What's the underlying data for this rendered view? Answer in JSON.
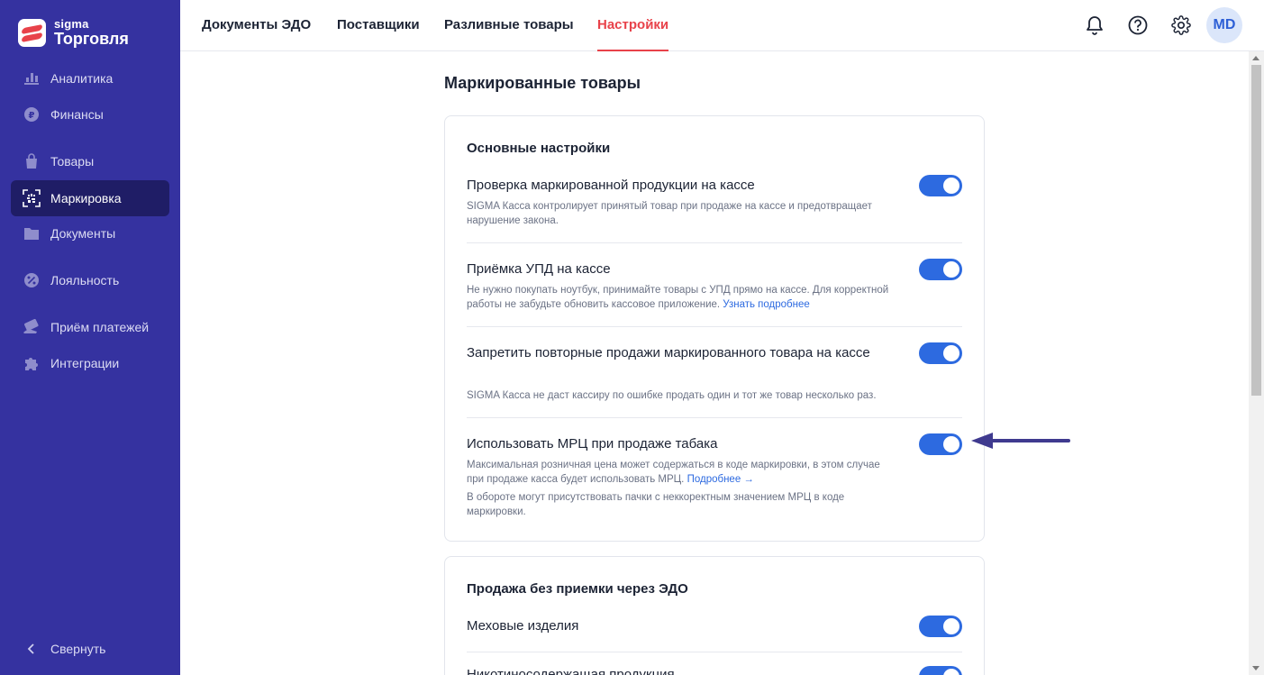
{
  "colors": {
    "sidebar_bg": "#3532a0",
    "sidebar_active_bg": "#1f1d66",
    "accent_red": "#e8424a",
    "toggle_on": "#2d6ae0",
    "link": "#2d6ae0",
    "annotation_arrow": "#3f3a8f"
  },
  "brand": {
    "small": "sigma",
    "big": "Торговля"
  },
  "sidebar": {
    "items": [
      {
        "label": "Аналитика",
        "icon": "bar-chart-icon"
      },
      {
        "label": "Финансы",
        "icon": "ruble-coin-icon"
      },
      {
        "label": "Товары",
        "icon": "shopping-bag-icon"
      },
      {
        "label": "Маркировка",
        "icon": "datamatrix-scan-icon",
        "active": true
      },
      {
        "label": "Документы",
        "icon": "folder-icon"
      },
      {
        "label": "Лояльность",
        "icon": "percent-badge-icon"
      },
      {
        "label": "Приём платежей",
        "icon": "card-payment-icon"
      },
      {
        "label": "Интеграции",
        "icon": "puzzle-icon"
      }
    ],
    "collapse_label": "Свернуть"
  },
  "topbar": {
    "tabs": [
      "Документы ЭДО",
      "Поставщики",
      "Разливные товары",
      "Настройки"
    ],
    "active_tab": "Настройки",
    "icons": [
      "bell-icon",
      "help-icon",
      "gear-icon"
    ],
    "avatar": "MD"
  },
  "page": {
    "title": "Маркированные товары",
    "card1": {
      "title": "Основные настройки",
      "rows": [
        {
          "title": "Проверка маркированной продукции на кассе",
          "desc": "SIGMA Касса контролирует принятый товар при продаже на кассе и предотвращает нарушение закона.",
          "enabled": true
        },
        {
          "title": "Приёмка УПД на кассе",
          "desc": "Не нужно покупать ноутбук, принимайте товары с УПД прямо на кассе. Для корректной работы не забудьте обновить кассовое приложение.",
          "link": "Узнать подробнее",
          "enabled": true
        },
        {
          "title": "Запретить повторные продажи маркированного товара на кассе",
          "desc": "SIGMA Касса не даст кассиру по ошибке продать один и тот же товар несколько раз.",
          "enabled": true
        },
        {
          "title": "Использовать МРЦ при продаже табака",
          "desc": "Максимальная розничная цена может содержаться в коде маркировки, в этом случае при продаже касса будет использовать МРЦ.",
          "link": "Подробнее →",
          "note": "В обороте могут присутствовать пачки с неккоректным значением МРЦ в коде маркировки.",
          "enabled": true
        }
      ]
    },
    "card2": {
      "title": "Продажа без приемки через ЭДО",
      "rows": [
        {
          "title": "Меховые изделия",
          "enabled": true
        },
        {
          "title": "Никотиносодержащая продукция",
          "enabled": true
        }
      ]
    }
  }
}
